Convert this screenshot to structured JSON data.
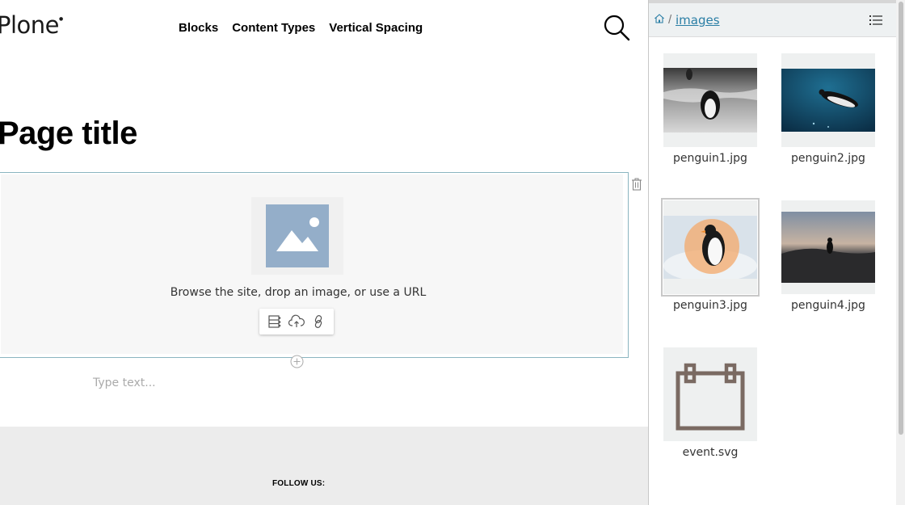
{
  "site": {
    "logo": "Plone",
    "nav": [
      "Blocks",
      "Content Types",
      "Vertical Spacing"
    ],
    "page_title": "Page title",
    "image_block": {
      "message": "Browse the site, drop an image, or use a URL"
    },
    "text_block": {
      "placeholder": "Type text..."
    },
    "footer": {
      "follow_label": "FOLLOW US:"
    },
    "colors": {
      "block_border": "#8bb5c0",
      "placeholder_icon": "#94aec9",
      "footer_bg": "#ececec"
    }
  },
  "sidebar": {
    "breadcrumb": {
      "separator": "/",
      "current": "images"
    },
    "items": [
      {
        "label": "penguin1.jpg",
        "selected": false
      },
      {
        "label": "penguin2.jpg",
        "selected": false
      },
      {
        "label": "penguin3.jpg",
        "selected": true
      },
      {
        "label": "penguin4.jpg",
        "selected": false
      },
      {
        "label": "event.svg",
        "selected": false
      }
    ],
    "colors": {
      "link": "#2a7ea5",
      "header_bg": "#eef1f2",
      "event_icon": "#7a6a62"
    }
  }
}
